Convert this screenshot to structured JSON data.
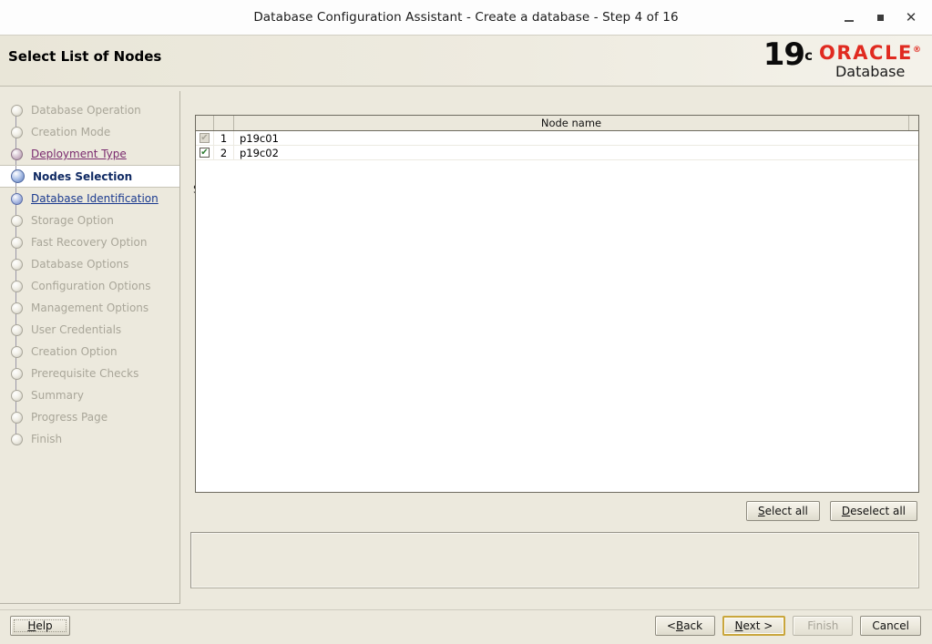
{
  "window": {
    "title": "Database Configuration Assistant - Create a database - Step 4 of 16",
    "minimize_icon": "minimize-icon",
    "maximize_icon": "maximize-icon",
    "close_icon": "close-icon"
  },
  "header": {
    "page_title": "Select List of Nodes",
    "logo": {
      "version": "19",
      "version_superscript": "c",
      "brand": "ORACLE",
      "registered": "®",
      "product": "Database",
      "brand_color": "#e02a20"
    }
  },
  "sidebar": {
    "items": [
      {
        "label": "Database Operation",
        "state": "disabled"
      },
      {
        "label": "Creation Mode",
        "state": "disabled"
      },
      {
        "label": "Deployment Type",
        "state": "visited"
      },
      {
        "label": "Nodes Selection",
        "state": "current"
      },
      {
        "label": "Database Identification",
        "state": "link"
      },
      {
        "label": "Storage Option",
        "state": "disabled"
      },
      {
        "label": "Fast Recovery Option",
        "state": "disabled"
      },
      {
        "label": "Database Options",
        "state": "disabled"
      },
      {
        "label": "Configuration Options",
        "state": "disabled"
      },
      {
        "label": "Management Options",
        "state": "disabled"
      },
      {
        "label": "User Credentials",
        "state": "disabled"
      },
      {
        "label": "Creation Option",
        "state": "disabled"
      },
      {
        "label": "Prerequisite Checks",
        "state": "disabled"
      },
      {
        "label": "Summary",
        "state": "disabled"
      },
      {
        "label": "Progress Page",
        "state": "disabled"
      },
      {
        "label": "Finish",
        "state": "disabled"
      }
    ]
  },
  "main": {
    "instruction": "Select the nodes on which you want to create the cluster database. The local node \"p19c01\" should always be selected.",
    "table": {
      "columns": [
        "",
        "",
        "Node name"
      ],
      "rows": [
        {
          "checked": true,
          "enabled": false,
          "index": "1",
          "node_name": "p19c01",
          "check_glyph": "✔"
        },
        {
          "checked": true,
          "enabled": true,
          "index": "2",
          "node_name": "p19c02",
          "check_glyph": "✔"
        }
      ]
    },
    "select_all_label": "Select all",
    "select_all_mnemonic": "S",
    "select_all_rest": "elect all",
    "deselect_all_label": "Deselect all",
    "deselect_all_mnemonic": "D",
    "deselect_all_rest": "eselect all",
    "message_panel_text": ""
  },
  "footer": {
    "help": {
      "mnemonic": "H",
      "rest": "elp",
      "label": "Help",
      "enabled": true
    },
    "back": {
      "prefix": "< ",
      "mnemonic": "B",
      "rest": "ack",
      "label": "< Back",
      "enabled": true
    },
    "next": {
      "mnemonic": "N",
      "rest": "ext >",
      "label": "Next >",
      "enabled": true,
      "is_default": true
    },
    "finish": {
      "mnemonic": "F",
      "rest": "inish",
      "label": "Finish",
      "enabled": false
    },
    "cancel": {
      "label": "Cancel",
      "enabled": true
    }
  }
}
